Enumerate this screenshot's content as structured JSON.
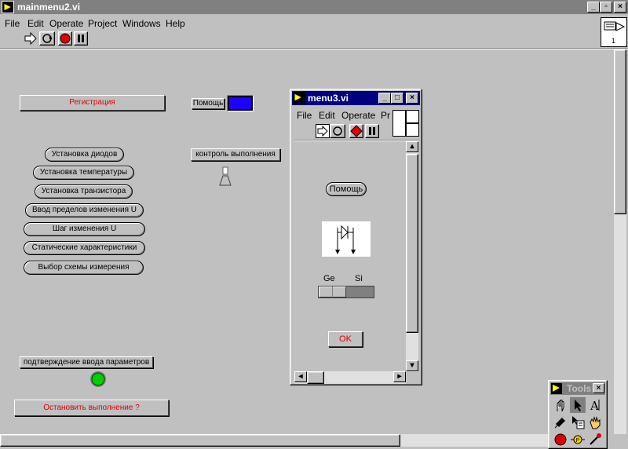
{
  "window": {
    "title": "mainmenu2.vi"
  },
  "menu": [
    {
      "label": "File"
    },
    {
      "label": "Edit"
    },
    {
      "label": "Operate"
    },
    {
      "label": "Project"
    },
    {
      "label": "Windows"
    },
    {
      "label": "Help"
    }
  ],
  "connector_number": "1",
  "panel": {
    "registration": "Регистрация",
    "help_label": "Помощь",
    "help_color": "#1e00ff",
    "buttons": [
      "Установка диодов",
      "Установка температуры",
      "Установка транзистора",
      "Ввод пределов изменения U",
      "Шаг изменения U",
      "Статические характеристики",
      "Выбор схемы измерения"
    ],
    "execution_control": "контроль выполнения",
    "confirm_label": "подтверждение ввода параметров",
    "led_color": "#00d000",
    "stop_button": "Остановить выполнение ?"
  },
  "subwindow": {
    "title": "menu3.vi",
    "menu": [
      {
        "label": "File"
      },
      {
        "label": "Edit"
      },
      {
        "label": "Operate"
      },
      {
        "label": "Pro"
      }
    ],
    "help_button": "Помощь",
    "slider": {
      "left": "Ge",
      "right": "Si"
    },
    "ok_button": "OK"
  },
  "tools": {
    "title": "Tools"
  }
}
